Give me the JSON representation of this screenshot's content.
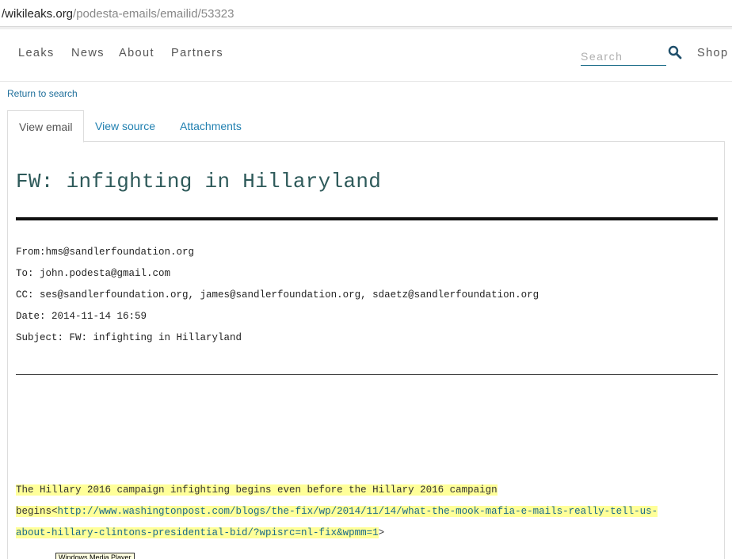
{
  "browser": {
    "url_host": "/wikileaks.org",
    "url_path": "/podesta-emails/emailid/53323"
  },
  "nav": {
    "items": [
      "Leaks",
      "News",
      "About",
      "Partners"
    ],
    "search_placeholder": "Search",
    "shop": "Shop"
  },
  "return_link": "Return to search",
  "tabs": [
    {
      "label": "View email",
      "active": true
    },
    {
      "label": "View source",
      "active": false
    },
    {
      "label": "Attachments",
      "active": false
    }
  ],
  "email": {
    "title": "FW: infighting in Hillaryland",
    "from": "From:hms@sandlerfoundation.org",
    "to": "To: john.podesta@gmail.com",
    "cc": "CC: ses@sandlerfoundation.org, james@sandlerfoundation.org, sdaetz@sandlerfoundation.org",
    "date": "Date: 2014-11-14 16:59",
    "subject": "Subject: FW: infighting in Hillaryland",
    "body_line1": "The Hillary 2016 campaign infighting begins even before the Hillary 2016 campaign",
    "body_line2_prefix": "begins<",
    "body_link_part1": "http://www.washingtonpost.com/blogs/the-fix/wp/2014/11/14/what-the-mook-mafia-e-mails-really-tell-us-",
    "body_link_part2": "about-hillary-clintons-presidential-bid/?wpisrc=nl-fix&wpmm=1",
    "body_line3_suffix": ">"
  },
  "tooltip": "Windows Media Player",
  "colors": {
    "highlight": "#ffff99",
    "link": "#1f7fb0",
    "title": "#2e5a5a"
  }
}
